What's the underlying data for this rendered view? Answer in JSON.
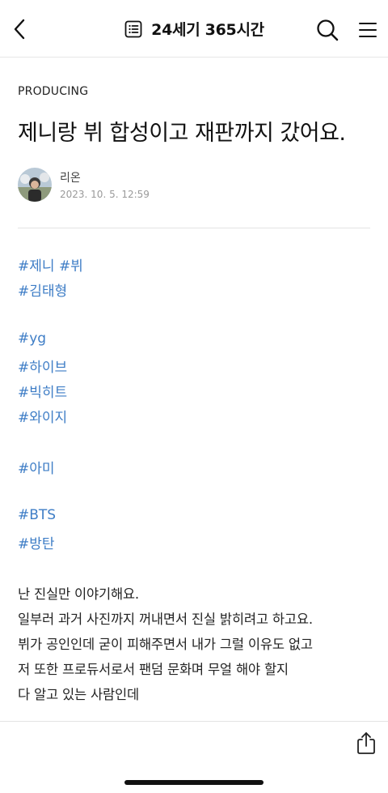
{
  "header": {
    "title": "24세기 365시간",
    "back_icon": "chevron-left-icon",
    "list_icon": "list-icon",
    "search_icon": "search-icon",
    "menu_icon": "hamburger-menu-icon"
  },
  "post": {
    "category": "PRODUCING",
    "title": "제니랑 뷔 합성이고 재판까지 갔어요.",
    "author": "리온",
    "date": "2023. 10. 5. 12:59"
  },
  "tags": {
    "line1": [
      "#제니",
      "#뷔"
    ],
    "line2": "#김태형",
    "line3": "#yg",
    "line4": "#하이브",
    "line5": "#빅히트",
    "line6": "#와이지",
    "line7": "#아미",
    "line8": "#BTS",
    "line9": "#방탄"
  },
  "body_text": [
    "난 진실만 이야기해요.",
    "일부러 과거 사진까지 꺼내면서 진실 밝히려고 하고요.",
    "뷔가 공인인데 굳이 피해주면서 내가 그럴 이유도 없고",
    "저 또한 프로듀서로서 팬덤 문화며 무얼 해야 할지",
    "다 알고 있는 사람인데"
  ],
  "footer": {
    "share_icon": "share-icon"
  },
  "colors": {
    "tag": "#3e7dc6",
    "text": "#111111",
    "meta": "#9a9a9a"
  }
}
